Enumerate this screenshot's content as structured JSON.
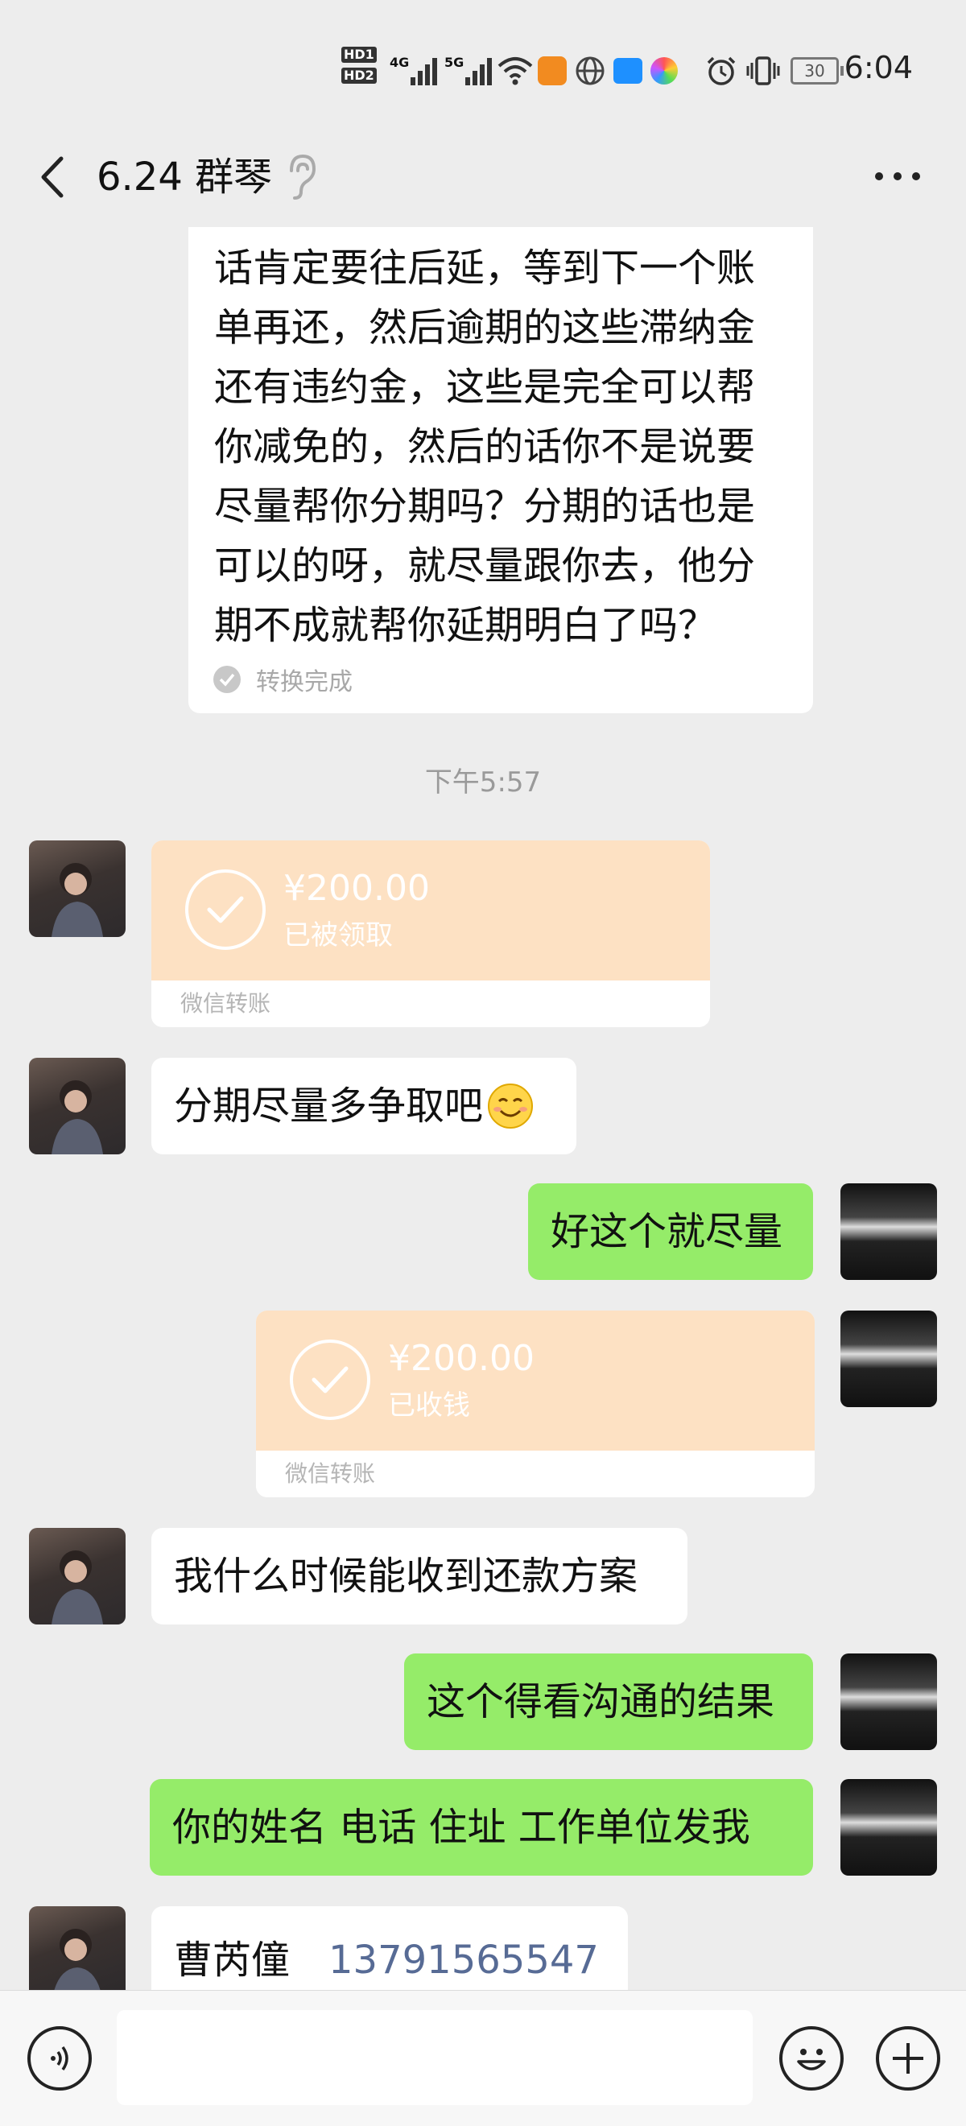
{
  "status_bar": {
    "hd1": "HD1",
    "hd2": "HD2",
    "net1": "4G",
    "net2": "5G",
    "battery": "30",
    "time": "6:04"
  },
  "header": {
    "title": "6.24 群琴"
  },
  "messages": {
    "voice_text_lines": [
      "话肯定要往后延，等到下一个账",
      "单再还，然后逾期的这些滞纳金",
      "还有违约金，这些是完全可以帮",
      "你减免的，然后的话你不是说要",
      "尽量帮你分期吗？分期的话也是",
      "可以的呀，就尽量跟你去，他分",
      "期不成就帮你延期明白了吗？"
    ],
    "voice_status": "转换完成",
    "timestamp": "下午5:57",
    "transfer1": {
      "amount": "¥200.00",
      "status": "已被领取",
      "label": "微信转账"
    },
    "msg1": "分期尽量多争取吧",
    "msg2": "好这个就尽量",
    "transfer2": {
      "amount": "¥200.00",
      "status": "已收钱",
      "label": "微信转账"
    },
    "msg3": "我什么时候能收到还款方案",
    "msg4": "这个得看沟通的结果",
    "msg5": "你的姓名 电话 住址 工作单位发我",
    "msg6_name": "曹芮僮",
    "msg6_phone": "13791565547"
  },
  "icons": {
    "back": "back-arrow-icon",
    "ear": "ear-icon",
    "more": "more-icon",
    "voice": "voice-icon",
    "emoji": "emoji-icon",
    "plus": "plus-icon"
  },
  "colors": {
    "background": "#ededed",
    "bubble_sent": "#95ec69",
    "bubble_received": "#ffffff",
    "transfer": "#fde1c3",
    "phone_link": "#576b95"
  }
}
